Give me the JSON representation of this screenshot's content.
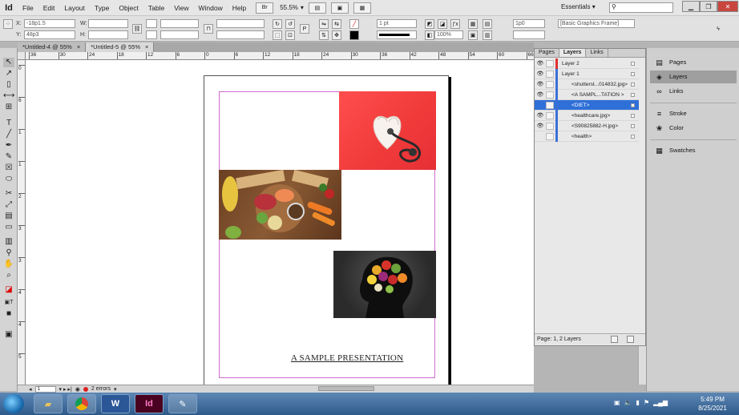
{
  "app": {
    "logo": "Id"
  },
  "menu": [
    "File",
    "Edit",
    "Layout",
    "Type",
    "Object",
    "Table",
    "View",
    "Window",
    "Help"
  ],
  "menubar_extra": {
    "zoom": "55.5%",
    "essentials": "Essentials",
    "search_placeholder": ""
  },
  "control": {
    "x_label": "X:",
    "x_value": "-18p1.5",
    "y_label": "Y:",
    "y_value": "48p3",
    "w_label": "W:",
    "h_label": "H:",
    "stroke_weight": "1 pt",
    "zoom_pct": "100%",
    "offset": "1p0",
    "frame_style": "[Basic Graphics Frame]"
  },
  "tabs": [
    "*Untitled-4 @ 55%",
    "*Untitled-5 @ 55%"
  ],
  "ruler": {
    "h": [
      "36",
      "30",
      "24",
      "18",
      "12",
      "6",
      "0",
      "6",
      "12",
      "18",
      "24",
      "30",
      "36",
      "42",
      "48",
      "54",
      "60",
      "66"
    ],
    "v": [
      "0",
      "6",
      "1",
      "1",
      "2",
      "3",
      "3",
      "4",
      "4",
      "5"
    ]
  },
  "page": {
    "title": "A SAMPLE PRESENTATION"
  },
  "status": {
    "page_field": "1",
    "errors": "2 errors"
  },
  "layers_panel": {
    "tabs": [
      "Pages",
      "Layers",
      "Links"
    ],
    "rows": [
      {
        "name": "Layer 2",
        "eye": true,
        "color": "#e03030",
        "selected": false
      },
      {
        "name": "Layer 1",
        "eye": true,
        "color": "#3a6fd8",
        "selected": false
      },
      {
        "name": "<shutterst...014832.jpg>",
        "eye": true,
        "color": "#3a6fd8",
        "selected": false
      },
      {
        "name": "<A SAMPL...TATION >",
        "eye": true,
        "color": "#3a6fd8",
        "selected": false
      },
      {
        "name": "<DIET>",
        "eye": false,
        "color": "#3a6fd8",
        "selected": true
      },
      {
        "name": "<healthcare.jpg>",
        "eye": true,
        "color": "#3a6fd8",
        "selected": false
      },
      {
        "name": "<S90825882-H.jpg>",
        "eye": true,
        "color": "#3a6fd8",
        "selected": false
      },
      {
        "name": "<health>",
        "eye": false,
        "color": "#3a6fd8",
        "selected": false
      }
    ],
    "footer": "Page: 1, 2 Layers"
  },
  "dock": {
    "items": [
      "Pages",
      "Layers",
      "Links",
      "Stroke",
      "Color",
      "Swatches"
    ]
  },
  "taskbar": {
    "time": "5:49 PM",
    "date": "8/25/2021"
  }
}
